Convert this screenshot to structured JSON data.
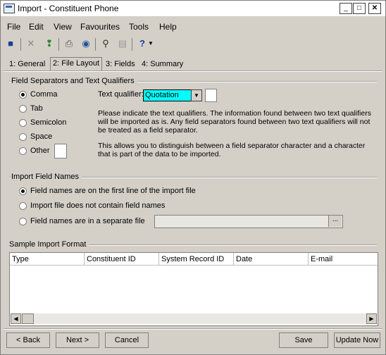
{
  "window": {
    "title": "Import - Constituent Phone"
  },
  "menu": [
    "File",
    "Edit",
    "View",
    "Favourites",
    "Tools",
    "Help"
  ],
  "toolbar": {
    "help_glyph": "?"
  },
  "tabs": [
    {
      "label": "1: General"
    },
    {
      "label": "2: File Layout"
    },
    {
      "label": "3: Fields"
    },
    {
      "label": "4: Summary"
    }
  ],
  "separators": {
    "group_title": "Field Separators and Text Qualifiers",
    "options": [
      "Comma",
      "Tab",
      "Semicolon",
      "Space",
      "Other"
    ],
    "selected": "Comma",
    "text_qualifier_label": "Text qualifier:",
    "text_qualifier_value": "Quotation",
    "para1": "Please indicate the text qualifiers.  The information found between two text qualifiers will be imported as is.  Any field separators found between two text qualifiers will not be treated as a field separator.",
    "para2": "This allows you to distinguish between a field separator character and a character that is part of the data to be imported."
  },
  "field_names": {
    "group_title": "Import Field Names",
    "options": [
      "Field names are on the first line of the import file",
      "Import file does not contain field names",
      "Field names are in a separate file"
    ],
    "selected": 0,
    "browse_label": "..."
  },
  "sample": {
    "group_title": "Sample Import Format",
    "columns": [
      "Type",
      "Constituent ID",
      "System Record ID",
      "Date",
      "E-mail"
    ]
  },
  "buttons": {
    "back": "< Back",
    "next": "Next >",
    "cancel": "Cancel",
    "save": "Save",
    "update_now": "Update Now"
  }
}
